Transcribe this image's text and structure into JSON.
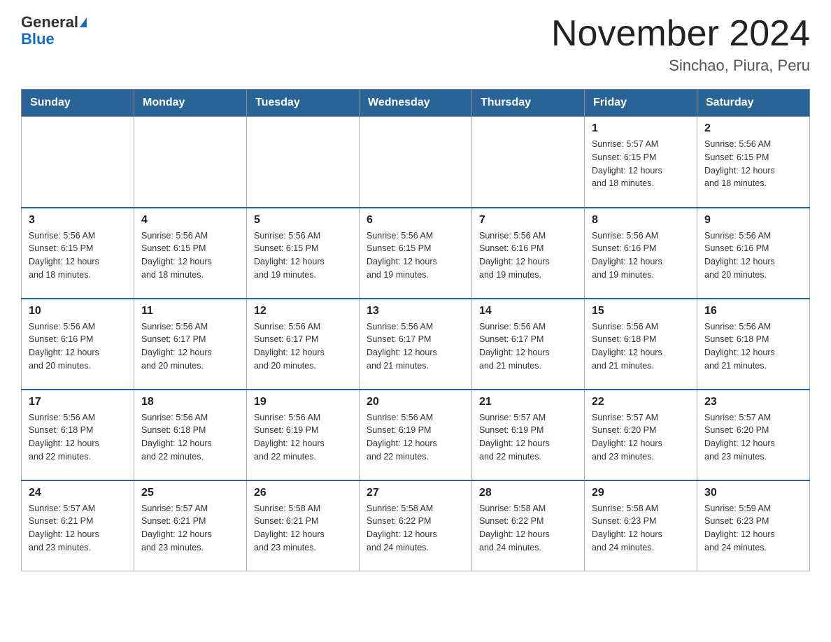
{
  "header": {
    "logo": {
      "line1": "General",
      "line2": "Blue"
    },
    "title": "November 2024",
    "subtitle": "Sinchao, Piura, Peru"
  },
  "days_of_week": [
    "Sunday",
    "Monday",
    "Tuesday",
    "Wednesday",
    "Thursday",
    "Friday",
    "Saturday"
  ],
  "weeks": [
    [
      {
        "day": "",
        "info": ""
      },
      {
        "day": "",
        "info": ""
      },
      {
        "day": "",
        "info": ""
      },
      {
        "day": "",
        "info": ""
      },
      {
        "day": "",
        "info": ""
      },
      {
        "day": "1",
        "info": "Sunrise: 5:57 AM\nSunset: 6:15 PM\nDaylight: 12 hours\nand 18 minutes."
      },
      {
        "day": "2",
        "info": "Sunrise: 5:56 AM\nSunset: 6:15 PM\nDaylight: 12 hours\nand 18 minutes."
      }
    ],
    [
      {
        "day": "3",
        "info": "Sunrise: 5:56 AM\nSunset: 6:15 PM\nDaylight: 12 hours\nand 18 minutes."
      },
      {
        "day": "4",
        "info": "Sunrise: 5:56 AM\nSunset: 6:15 PM\nDaylight: 12 hours\nand 18 minutes."
      },
      {
        "day": "5",
        "info": "Sunrise: 5:56 AM\nSunset: 6:15 PM\nDaylight: 12 hours\nand 19 minutes."
      },
      {
        "day": "6",
        "info": "Sunrise: 5:56 AM\nSunset: 6:15 PM\nDaylight: 12 hours\nand 19 minutes."
      },
      {
        "day": "7",
        "info": "Sunrise: 5:56 AM\nSunset: 6:16 PM\nDaylight: 12 hours\nand 19 minutes."
      },
      {
        "day": "8",
        "info": "Sunrise: 5:56 AM\nSunset: 6:16 PM\nDaylight: 12 hours\nand 19 minutes."
      },
      {
        "day": "9",
        "info": "Sunrise: 5:56 AM\nSunset: 6:16 PM\nDaylight: 12 hours\nand 20 minutes."
      }
    ],
    [
      {
        "day": "10",
        "info": "Sunrise: 5:56 AM\nSunset: 6:16 PM\nDaylight: 12 hours\nand 20 minutes."
      },
      {
        "day": "11",
        "info": "Sunrise: 5:56 AM\nSunset: 6:17 PM\nDaylight: 12 hours\nand 20 minutes."
      },
      {
        "day": "12",
        "info": "Sunrise: 5:56 AM\nSunset: 6:17 PM\nDaylight: 12 hours\nand 20 minutes."
      },
      {
        "day": "13",
        "info": "Sunrise: 5:56 AM\nSunset: 6:17 PM\nDaylight: 12 hours\nand 21 minutes."
      },
      {
        "day": "14",
        "info": "Sunrise: 5:56 AM\nSunset: 6:17 PM\nDaylight: 12 hours\nand 21 minutes."
      },
      {
        "day": "15",
        "info": "Sunrise: 5:56 AM\nSunset: 6:18 PM\nDaylight: 12 hours\nand 21 minutes."
      },
      {
        "day": "16",
        "info": "Sunrise: 5:56 AM\nSunset: 6:18 PM\nDaylight: 12 hours\nand 21 minutes."
      }
    ],
    [
      {
        "day": "17",
        "info": "Sunrise: 5:56 AM\nSunset: 6:18 PM\nDaylight: 12 hours\nand 22 minutes."
      },
      {
        "day": "18",
        "info": "Sunrise: 5:56 AM\nSunset: 6:18 PM\nDaylight: 12 hours\nand 22 minutes."
      },
      {
        "day": "19",
        "info": "Sunrise: 5:56 AM\nSunset: 6:19 PM\nDaylight: 12 hours\nand 22 minutes."
      },
      {
        "day": "20",
        "info": "Sunrise: 5:56 AM\nSunset: 6:19 PM\nDaylight: 12 hours\nand 22 minutes."
      },
      {
        "day": "21",
        "info": "Sunrise: 5:57 AM\nSunset: 6:19 PM\nDaylight: 12 hours\nand 22 minutes."
      },
      {
        "day": "22",
        "info": "Sunrise: 5:57 AM\nSunset: 6:20 PM\nDaylight: 12 hours\nand 23 minutes."
      },
      {
        "day": "23",
        "info": "Sunrise: 5:57 AM\nSunset: 6:20 PM\nDaylight: 12 hours\nand 23 minutes."
      }
    ],
    [
      {
        "day": "24",
        "info": "Sunrise: 5:57 AM\nSunset: 6:21 PM\nDaylight: 12 hours\nand 23 minutes."
      },
      {
        "day": "25",
        "info": "Sunrise: 5:57 AM\nSunset: 6:21 PM\nDaylight: 12 hours\nand 23 minutes."
      },
      {
        "day": "26",
        "info": "Sunrise: 5:58 AM\nSunset: 6:21 PM\nDaylight: 12 hours\nand 23 minutes."
      },
      {
        "day": "27",
        "info": "Sunrise: 5:58 AM\nSunset: 6:22 PM\nDaylight: 12 hours\nand 24 minutes."
      },
      {
        "day": "28",
        "info": "Sunrise: 5:58 AM\nSunset: 6:22 PM\nDaylight: 12 hours\nand 24 minutes."
      },
      {
        "day": "29",
        "info": "Sunrise: 5:58 AM\nSunset: 6:23 PM\nDaylight: 12 hours\nand 24 minutes."
      },
      {
        "day": "30",
        "info": "Sunrise: 5:59 AM\nSunset: 6:23 PM\nDaylight: 12 hours\nand 24 minutes."
      }
    ]
  ]
}
